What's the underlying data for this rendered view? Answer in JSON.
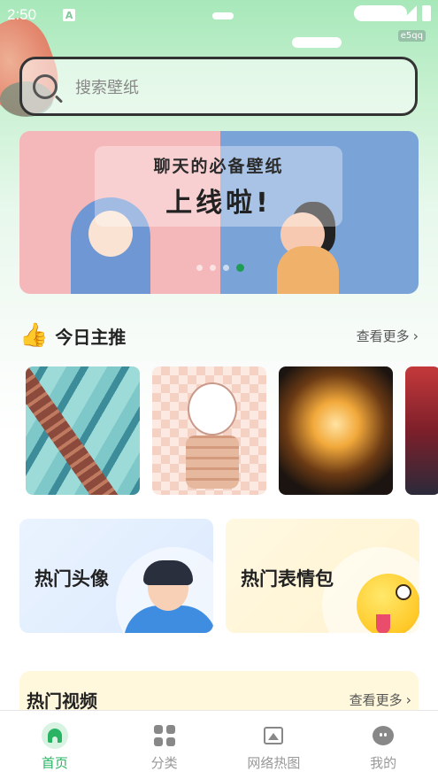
{
  "status_bar": {
    "time": "2:50",
    "notification_letter": "A",
    "tag": "e5qq"
  },
  "search": {
    "placeholder": "搜索壁纸"
  },
  "banner": {
    "line1": "聊天的必备壁纸",
    "line2": "上线啦!",
    "page_count": 4,
    "active_page": 4
  },
  "today": {
    "title": "今日主推",
    "more": "查看更多",
    "icon": "thumbs-up-icon"
  },
  "categories": [
    {
      "label": "热门头像"
    },
    {
      "label": "热门表情包"
    }
  ],
  "video": {
    "title": "热门视频",
    "more": "查看更多"
  },
  "tabbar": {
    "items": [
      {
        "label": "首页",
        "icon": "home-icon",
        "active": true
      },
      {
        "label": "分类",
        "icon": "grid-icon",
        "active": false
      },
      {
        "label": "网络热图",
        "icon": "image-icon",
        "active": false
      },
      {
        "label": "我的",
        "icon": "profile-icon",
        "active": false
      }
    ]
  },
  "colors": {
    "accent": "#28b463",
    "header_green": "#a7e8b9"
  }
}
